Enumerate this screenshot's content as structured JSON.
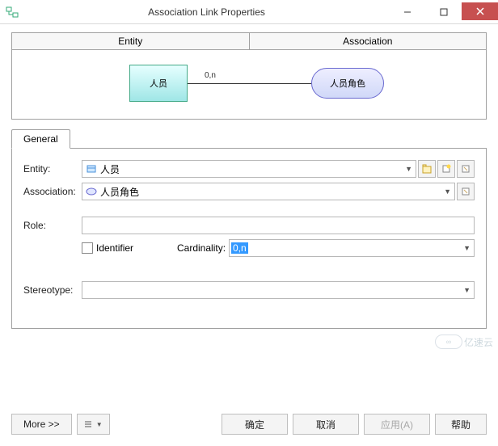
{
  "window": {
    "title": "Association Link Properties"
  },
  "header": {
    "entity": "Entity",
    "association": "Association"
  },
  "diagram": {
    "entity_name": "人员",
    "association_name": "人员角色",
    "cardinality": "0,n"
  },
  "tabs": {
    "general": "General"
  },
  "form": {
    "entity_label": "Entity:",
    "entity_value": "人员",
    "association_label": "Association:",
    "association_value": "人员角色",
    "role_label": "Role:",
    "role_value": "",
    "identifier_label": "Identifier",
    "cardinality_label": "Cardinality:",
    "cardinality_value": "0,n",
    "stereotype_label": "Stereotype:",
    "stereotype_value": ""
  },
  "buttons": {
    "more": "More >>",
    "ok": "确定",
    "cancel": "取消",
    "apply": "应用(A)",
    "help": "帮助"
  },
  "watermark": "亿速云"
}
